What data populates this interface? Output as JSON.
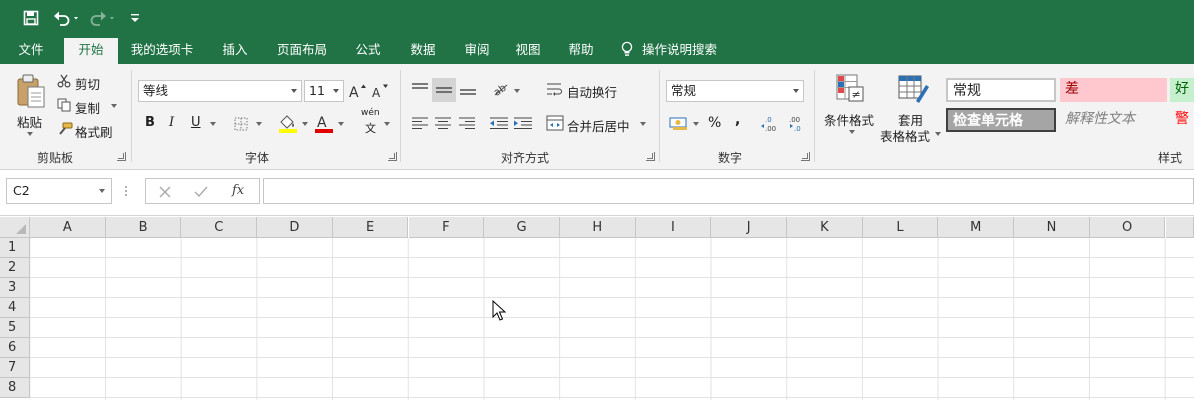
{
  "quick_access": {
    "save_icon": "save-icon",
    "undo_icon": "undo-icon",
    "redo_icon": "redo-icon",
    "customize_icon": "customize-qat-icon"
  },
  "tabs": [
    "文件",
    "开始",
    "我的选项卡",
    "插入",
    "页面布局",
    "公式",
    "数据",
    "审阅",
    "视图",
    "帮助"
  ],
  "active_tab": "开始",
  "tell_me": "操作说明搜索",
  "clipboard": {
    "paste": "粘贴",
    "cut": "剪切",
    "copy": "复制",
    "format_painter": "格式刷",
    "group": "剪贴板"
  },
  "font": {
    "name": "等线",
    "size": "11",
    "bold": "B",
    "italic": "I",
    "underline": "U",
    "phonetic": "wén",
    "phonetic_char": "文",
    "group": "字体"
  },
  "alignment": {
    "wrap": "自动换行",
    "merge": "合并后居中",
    "group": "对齐方式"
  },
  "number": {
    "format": "常规",
    "percent": "%",
    "comma": ",",
    "inc_decimal": "←0 .00",
    "dec_decimal": ".00 →0",
    "group": "数字"
  },
  "styles": {
    "conditional": "条件格式",
    "table_format_1": "套用",
    "table_format_2": "表格格式",
    "normal": "常规",
    "bad": "差",
    "good": "好",
    "check_cell": "检查单元格",
    "explanatory": "解释性文本",
    "warning": "警",
    "group": "样式"
  },
  "formula_bar": {
    "name_box": "C2",
    "fx": "fx",
    "value": ""
  },
  "columns": [
    "A",
    "B",
    "C",
    "D",
    "E",
    "F",
    "G",
    "H",
    "I",
    "J",
    "K",
    "L",
    "M",
    "N",
    "O"
  ],
  "rows": [
    "1",
    "2",
    "3",
    "4",
    "5",
    "6",
    "7",
    "8"
  ],
  "colors": {
    "accent": "#217346",
    "bad_bg": "#ffc7ce",
    "bad_fg": "#9c0006",
    "good_bg": "#c6efce",
    "good_fg": "#006100",
    "check_bg": "#a5a5a5",
    "warning_fg": "#ff0000"
  }
}
